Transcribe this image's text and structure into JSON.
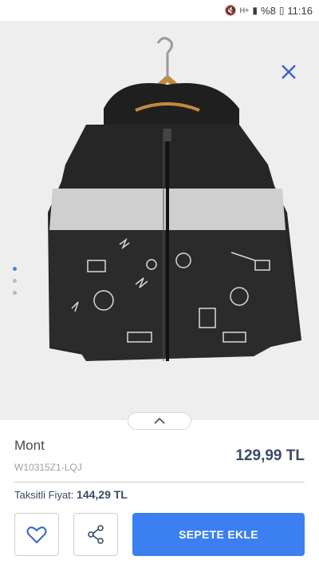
{
  "status_bar": {
    "network": "H+",
    "battery": "%8",
    "time": "11:16",
    "icons": [
      "mute-icon",
      "signal-icon",
      "battery-icon"
    ]
  },
  "product": {
    "title": "Mont",
    "sku": "W10315Z1-LQJ",
    "price": "129,99 TL",
    "installment_label": "Taksitli Fiyat:",
    "installment_price": "144,29 TL"
  },
  "gallery": {
    "image_count": 3,
    "active_index": 0
  },
  "actions": {
    "add_to_cart_label": "SEPETE EKLE"
  },
  "colors": {
    "accent": "#3b7ff0",
    "price_text": "#3a4a66",
    "close_icon": "#3a64c8"
  }
}
